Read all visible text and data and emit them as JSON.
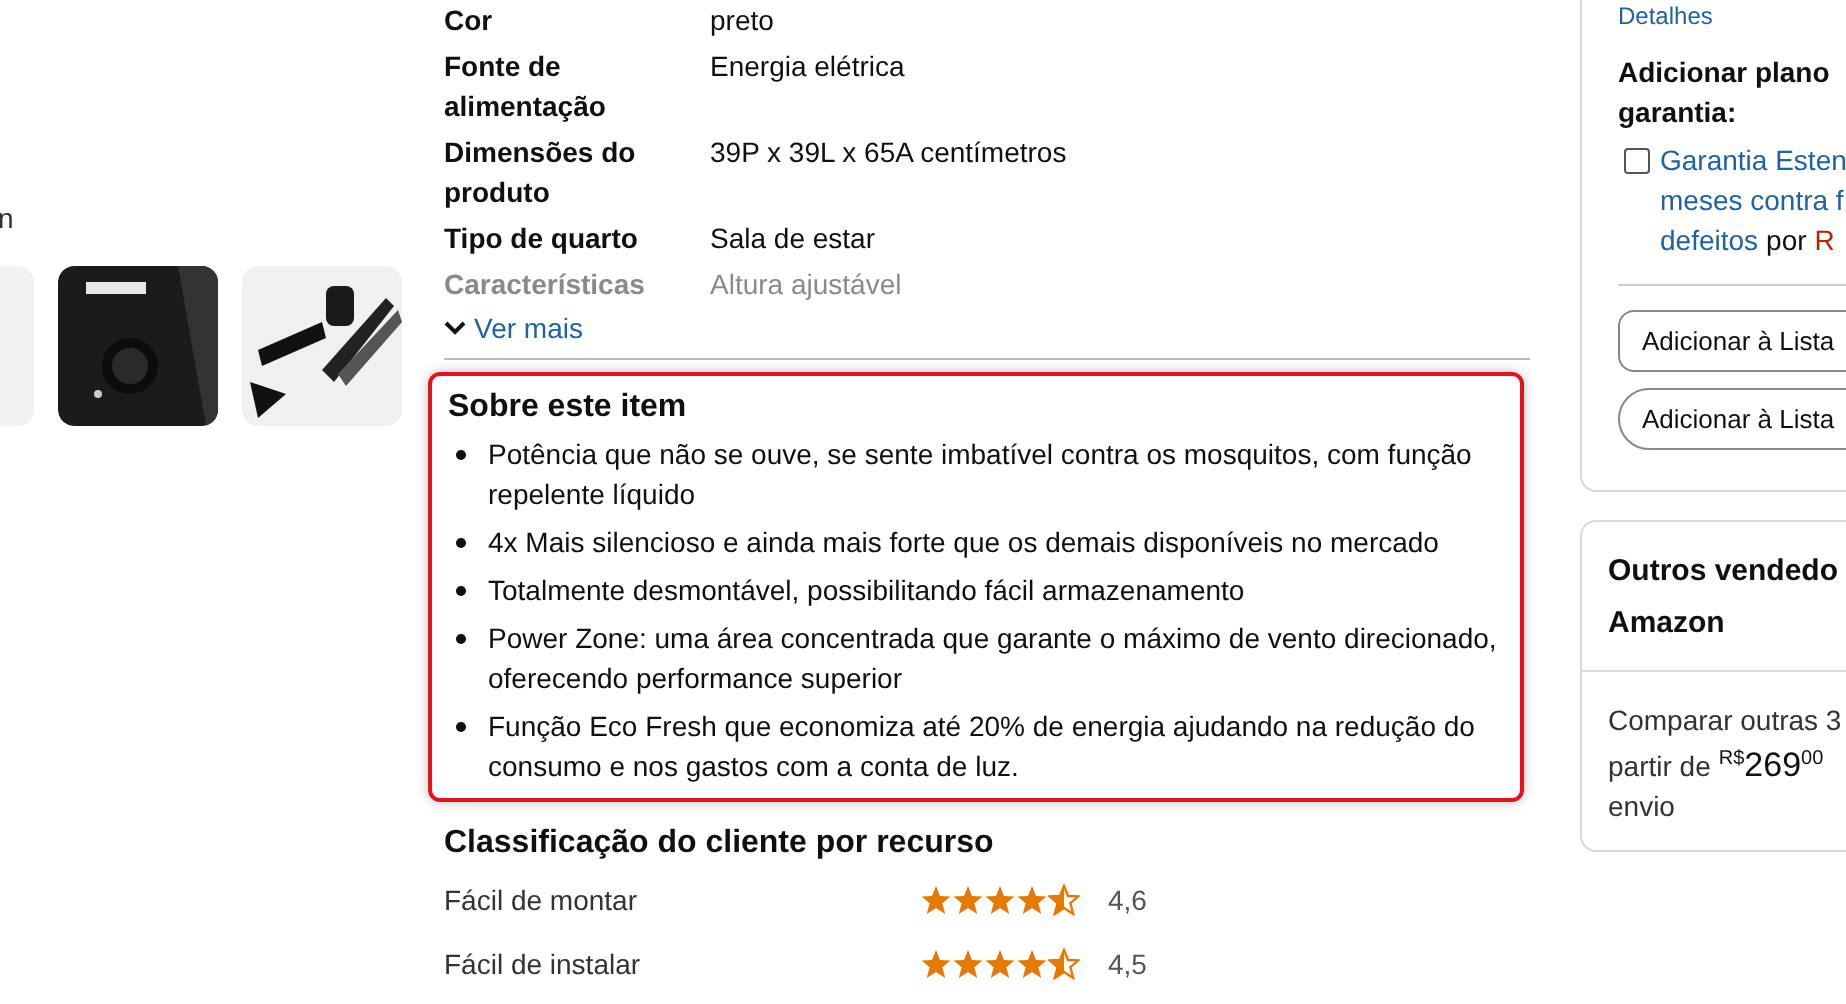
{
  "gallery": {
    "caption": "n"
  },
  "specs": {
    "rows": [
      {
        "label": "Cor",
        "value": "preto",
        "faded": false
      },
      {
        "label": "Fonte de alimentação",
        "value": "Energia elétrica",
        "faded": false
      },
      {
        "label": "Dimensões do produto",
        "value": "39P x 39L x 65A centímetros",
        "faded": false
      },
      {
        "label": "Tipo de quarto",
        "value": "Sala de estar",
        "faded": false
      },
      {
        "label": "Características",
        "value": "Altura ajustável",
        "faded": true
      }
    ],
    "more_link": "Ver mais"
  },
  "about": {
    "title": "Sobre este item",
    "highlighted": true,
    "bullets": [
      "Potência que não se ouve, se sente imbatível contra os mosquitos, com função repelente líquido",
      "4x Mais silencioso e ainda mais forte que os demais disponíveis no mercado",
      "Totalmente desmontável, possibilitando fácil armazenamento",
      "Power Zone: uma área concentrada que garante o máximo de vento direcionado, oferecendo performance superior",
      "Função Eco Fresh que economiza até 20% de energia ajudando na redução do consumo e nos gastos com a conta de luz."
    ]
  },
  "ratings": {
    "title": "Classificação do cliente por recurso",
    "rows": [
      {
        "label": "Fácil de montar",
        "stars": 4.5,
        "reading": "4,6"
      },
      {
        "label": "Fácil de instalar",
        "stars": 4.5,
        "reading": "4,5"
      }
    ]
  },
  "buy_box": {
    "details_link": "Detalhes",
    "warranty_title_lines": [
      "Adicionar plano",
      "garantia:"
    ],
    "warranty_option": {
      "checked": false,
      "lines": [
        [
          {
            "text": "Garantia Esten",
            "kind": "link"
          }
        ],
        [
          {
            "text": "meses contra f",
            "kind": "link"
          }
        ],
        [
          {
            "text": "defeitos",
            "kind": "link"
          },
          {
            "text": "por",
            "kind": "plain"
          },
          {
            "text": "R",
            "kind": "price"
          }
        ]
      ]
    },
    "buttons": [
      {
        "label": "Adicionar à Lista"
      },
      {
        "label": "Adicionar à Lista"
      }
    ]
  },
  "other_sellers": {
    "title_lines": [
      "Outros vendedo",
      "Amazon"
    ],
    "compare_text": "Comparar outras 3",
    "from_text": "partir de",
    "price": {
      "currency": "R$",
      "whole": "269",
      "cents": "00"
    },
    "shipping_text": "envio"
  }
}
